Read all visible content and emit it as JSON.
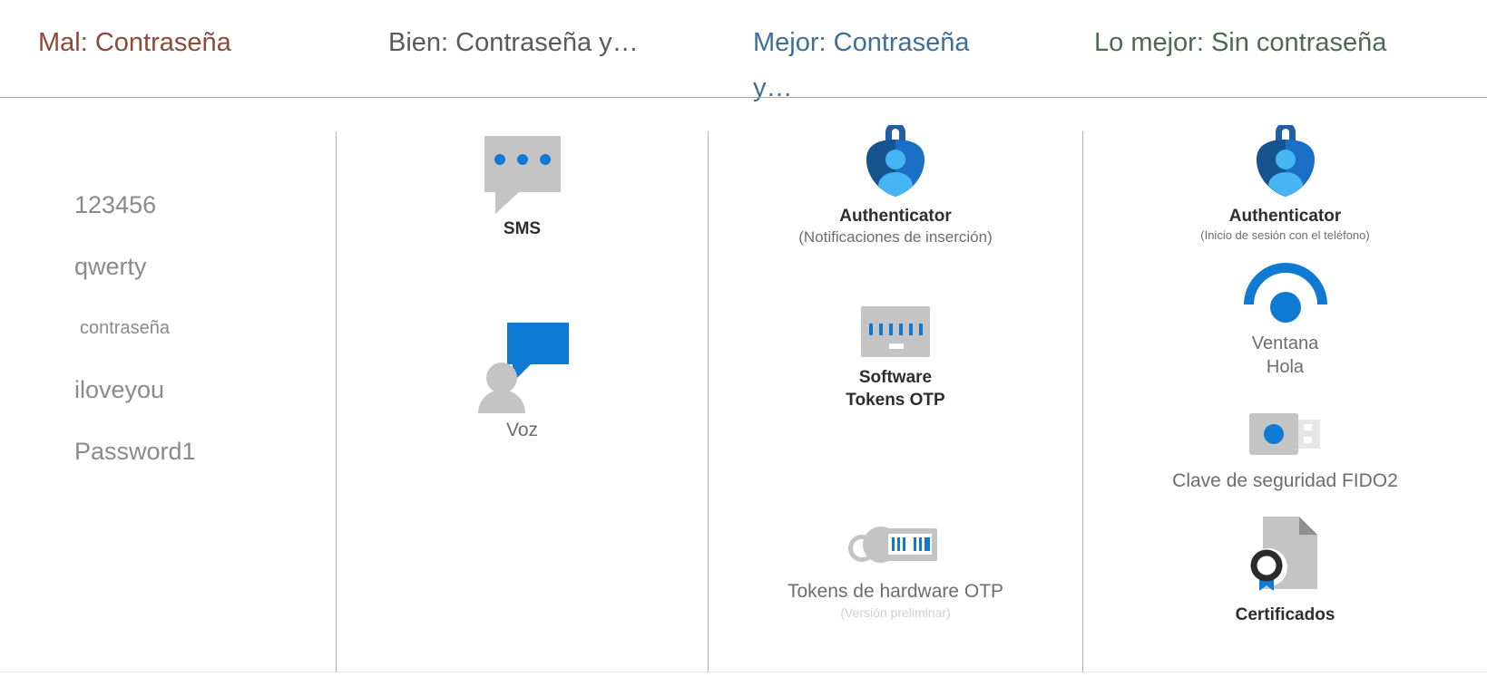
{
  "columns": [
    {
      "header": "Mal: Contraseña",
      "header_color": "#8c4a39",
      "passwords": [
        "123456",
        "qwerty",
        "contraseña",
        "iloveyou",
        "Password1"
      ]
    },
    {
      "header": "Bien: Contraseña y…",
      "header_color": "#5a5a5a",
      "items": [
        {
          "label": "SMS",
          "icon": "sms-message-bubble-icon"
        },
        {
          "label": "Voz",
          "icon": "voice-call-person-icon"
        }
      ]
    },
    {
      "header": "Mejor: Contraseña y…",
      "header_color": "#3f6e96",
      "items": [
        {
          "label": "Authenticator",
          "sub": "(Notificaciones de inserción)",
          "icon": "authenticator-shield-icon"
        },
        {
          "label_line1": "Software",
          "label_line2": "Tokens OTP",
          "icon": "software-otp-token-icon"
        },
        {
          "label": "Tokens de hardware OTP",
          "sub": "(Versión preliminar)",
          "icon": "hardware-otp-token-icon"
        }
      ]
    },
    {
      "header": "Lo mejor: Sin contraseña",
      "header_color": "#4a6b50",
      "items": [
        {
          "label": "Authenticator",
          "sub": "(Inicio de sesión con el teléfono)",
          "icon": "authenticator-shield-icon"
        },
        {
          "label_line1": "Ventana",
          "label_line2": "Hola",
          "icon": "windows-hello-icon"
        },
        {
          "label": "Clave de seguridad FIDO2",
          "icon": "fido2-security-key-icon"
        },
        {
          "label": "Certificados",
          "icon": "certificate-document-icon"
        }
      ]
    }
  ],
  "colors": {
    "accent_blue": "#0f7ad4",
    "icon_gray": "#c4c4c4",
    "text_gray": "#6d6d6d",
    "password_gray": "#8a8a8a",
    "faint_gray": "#cfcfcf",
    "divider": "#b3b3b3"
  }
}
